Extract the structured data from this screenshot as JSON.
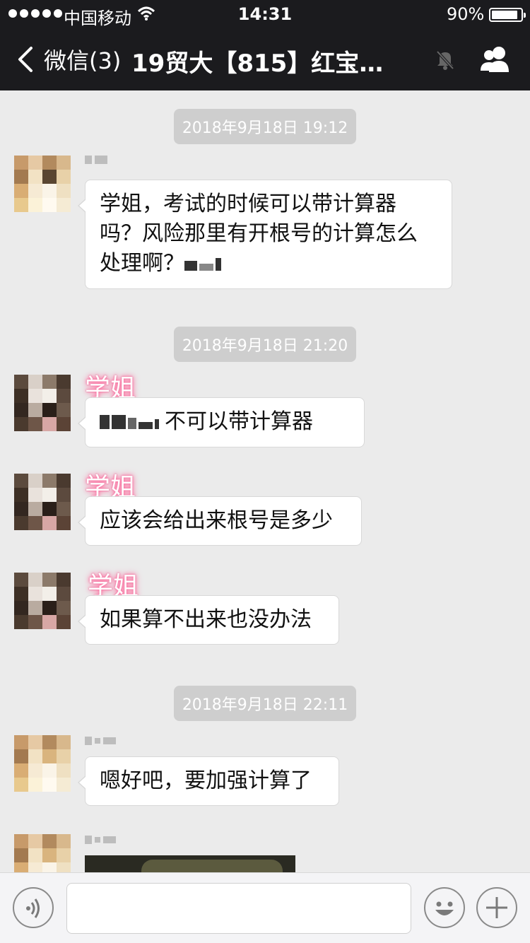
{
  "status_bar": {
    "carrier": "中国移动",
    "time": "14:31",
    "battery_percent": "90%",
    "battery_level": 0.9
  },
  "nav": {
    "back_label": "微信(3)",
    "title": "19贸大【815】红宝…"
  },
  "timestamps": [
    "2018年9月18日 19:12",
    "2018年9月18日 21:20",
    "2018年9月18日 22:11"
  ],
  "messages": [
    {
      "sender": "",
      "text_lines": [
        "学姐，考试的时候可以带计算器",
        "吗？风险那里有开根号的计算怎么",
        "处理啊？"
      ]
    },
    {
      "sender": "学姐",
      "text": "不可以带计算器"
    },
    {
      "sender": "学姐",
      "text": "应该会给出来根号是多少"
    },
    {
      "sender": "学姐",
      "text": "如果算不出来也没办法"
    },
    {
      "sender": "",
      "text": "嗯好吧，要加强计算了"
    },
    {
      "sender": "",
      "type": "image"
    }
  ],
  "colors": {
    "topbar": "#1b1b1e",
    "chat_background": "#ebebeb",
    "timestamp_chip": "#cecece",
    "sender_glow": "#ff6fa0"
  },
  "icons": {
    "back": "chevron-left-icon",
    "mute": "bell-off-icon",
    "group": "group-members-icon",
    "voice": "voice-icon",
    "emoji": "emoji-icon",
    "more": "plus-icon"
  }
}
